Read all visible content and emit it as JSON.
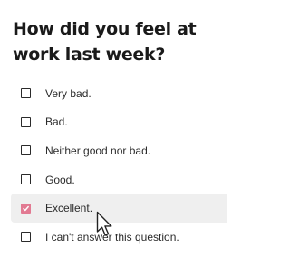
{
  "survey": {
    "question": "How did you feel at work last week?",
    "selected_index": 4,
    "options": [
      {
        "label": "Very bad.",
        "checked": false
      },
      {
        "label": "Bad.",
        "checked": false
      },
      {
        "label": "Neither good nor bad.",
        "checked": false
      },
      {
        "label": "Good.",
        "checked": false
      },
      {
        "label": "Excellent.",
        "checked": true
      },
      {
        "label": "I can't answer this question.",
        "checked": false
      }
    ]
  },
  "colors": {
    "accent": "#e27a92",
    "selected_row_background": "#efefef",
    "text": "#1a1a1a"
  },
  "icons": {
    "checkbox_checked": "checkmark-icon",
    "pointer": "mouse-pointer-icon"
  }
}
